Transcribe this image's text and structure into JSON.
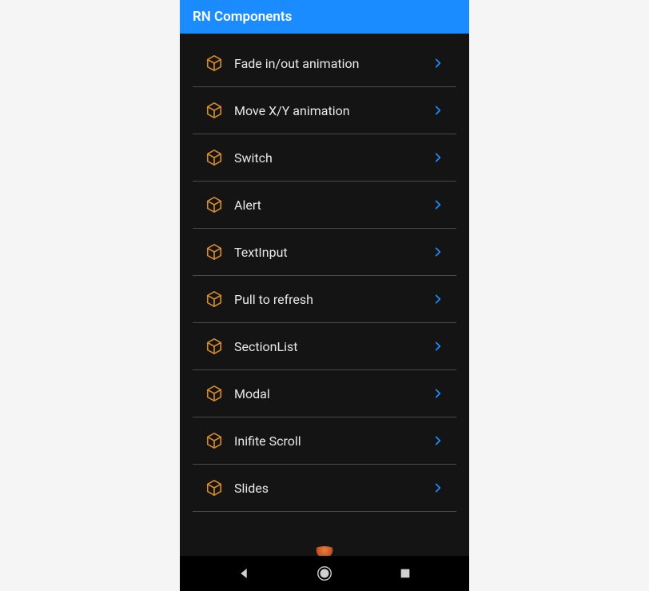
{
  "header": {
    "title": "RN Components"
  },
  "items": [
    {
      "label": "Fade in/out animation",
      "name": "fade-animation"
    },
    {
      "label": "Move X/Y animation",
      "name": "move-animation"
    },
    {
      "label": "Switch",
      "name": "switch"
    },
    {
      "label": "Alert",
      "name": "alert"
    },
    {
      "label": "TextInput",
      "name": "textinput"
    },
    {
      "label": "Pull to refresh",
      "name": "pull-to-refresh"
    },
    {
      "label": "SectionList",
      "name": "sectionlist"
    },
    {
      "label": "Modal",
      "name": "modal"
    },
    {
      "label": "Inifite Scroll",
      "name": "infinite-scroll"
    },
    {
      "label": "Slides",
      "name": "slides"
    }
  ],
  "colors": {
    "headerBg": "#1a8cff",
    "boxIcon": "#d68a2e",
    "chevron": "#1a8cff"
  }
}
